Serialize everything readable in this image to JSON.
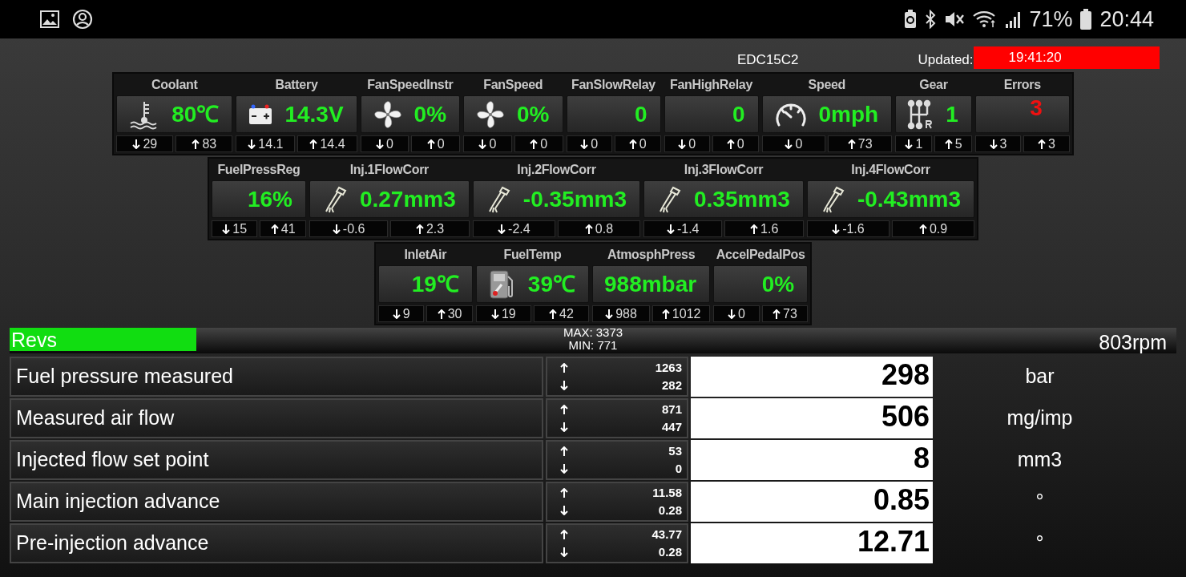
{
  "status_bar": {
    "battery": "71%",
    "time": "20:44"
  },
  "header": {
    "ecu": "EDC15C2",
    "updated_label": "Updated:",
    "updated_time": "19:41:20"
  },
  "gauge_rows": [
    [
      {
        "label": "Coolant",
        "kind": "thermometer",
        "value": "80℃",
        "alert": false,
        "min": "29",
        "max": "83"
      },
      {
        "label": "Battery",
        "kind": "battery",
        "value": "14.3V",
        "alert": false,
        "min": "14.1",
        "max": "14.4"
      },
      {
        "label": "FanSpeedInstr",
        "kind": "fan",
        "value": "0%",
        "alert": false,
        "min": "0",
        "max": "0"
      },
      {
        "label": "FanSpeed",
        "kind": "fan",
        "value": "0%",
        "alert": false,
        "min": "0",
        "max": "0"
      },
      {
        "label": "FanSlowRelay",
        "kind": "plain",
        "value": "0",
        "alert": false,
        "min": "0",
        "max": "0"
      },
      {
        "label": "FanHighRelay",
        "kind": "plain",
        "value": "0",
        "alert": false,
        "min": "0",
        "max": "0"
      },
      {
        "label": "Speed",
        "kind": "speedometer",
        "value": "0mph",
        "alert": false,
        "min": "0",
        "max": "73"
      },
      {
        "label": "Gear",
        "kind": "gearstick",
        "value": "1",
        "alert": false,
        "min": "1",
        "max": "5"
      },
      {
        "label": "Errors",
        "kind": "plain",
        "value": "3",
        "alert": true,
        "min": "3",
        "max": "3"
      }
    ],
    [
      {
        "label": "FuelPressReg",
        "kind": "plain",
        "value": "16%",
        "alert": false,
        "min": "15",
        "max": "41"
      },
      {
        "label": "Inj.1FlowCorr",
        "kind": "injector",
        "value": "0.27mm3",
        "alert": false,
        "min": "-0.6",
        "max": "2.3"
      },
      {
        "label": "Inj.2FlowCorr",
        "kind": "injector",
        "value": "-0.35mm3",
        "alert": false,
        "min": "-2.4",
        "max": "0.8"
      },
      {
        "label": "Inj.3FlowCorr",
        "kind": "injector",
        "value": "0.35mm3",
        "alert": false,
        "min": "-1.4",
        "max": "1.6"
      },
      {
        "label": "Inj.4FlowCorr",
        "kind": "injector",
        "value": "-0.43mm3",
        "alert": false,
        "min": "-1.6",
        "max": "0.9"
      }
    ],
    [
      {
        "label": "InletAir",
        "kind": "plain",
        "value": "19℃",
        "alert": false,
        "min": "9",
        "max": "30"
      },
      {
        "label": "FuelTemp",
        "kind": "fuelpump",
        "value": "39℃",
        "alert": false,
        "min": "19",
        "max": "42"
      },
      {
        "label": "AtmosphPress",
        "kind": "plain",
        "value": "988mbar",
        "alert": false,
        "min": "988",
        "max": "1012"
      },
      {
        "label": "AccelPedalPos",
        "kind": "plain",
        "value": "0%",
        "alert": false,
        "min": "0",
        "max": "73"
      }
    ]
  ],
  "revs": {
    "label": "Revs",
    "level": 0.16,
    "max": "MAX: 3373",
    "min": "MIN: 771",
    "value": "803rpm"
  },
  "readings": [
    {
      "name": "Fuel pressure measured",
      "max": "1263",
      "min": "282",
      "value": "298",
      "unit": "bar"
    },
    {
      "name": "Measured air flow",
      "max": "871",
      "min": "447",
      "value": "506",
      "unit": "mg/imp"
    },
    {
      "name": "Injected flow set point",
      "max": "53",
      "min": "0",
      "value": "8",
      "unit": "mm3"
    },
    {
      "name": "Main injection advance",
      "max": "11.58",
      "min": "0.28",
      "value": "0.85",
      "unit": "°"
    },
    {
      "name": "Pre-injection advance",
      "max": "43.77",
      "min": "0.28",
      "value": "12.71",
      "unit": "°"
    }
  ]
}
